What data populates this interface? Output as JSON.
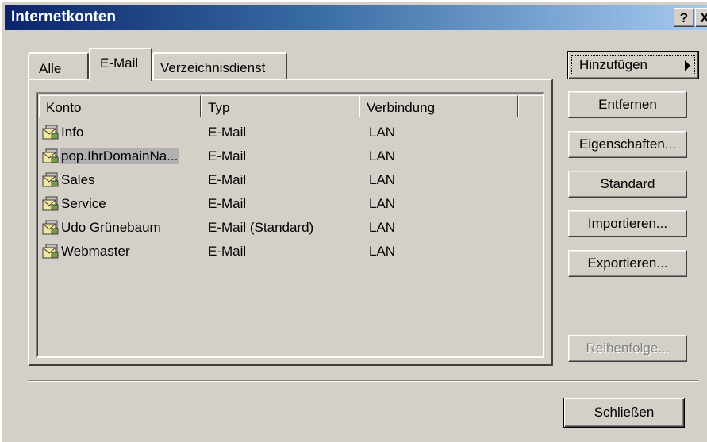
{
  "window": {
    "title": "Internetkonten"
  },
  "titlebar": {
    "help_label": "?",
    "close_label": "X"
  },
  "tabs": [
    {
      "label": "Alle"
    },
    {
      "label": "E-Mail",
      "selected": true
    },
    {
      "label": "Verzeichnisdienst"
    }
  ],
  "list": {
    "columns": [
      "Konto",
      "Typ",
      "Verbindung"
    ],
    "rows": [
      {
        "konto": "Info",
        "typ": "E-Mail",
        "verbindung": "LAN"
      },
      {
        "konto": "pop.IhrDomainNa...",
        "typ": "E-Mail",
        "verbindung": "LAN",
        "selected": true
      },
      {
        "konto": "Sales",
        "typ": "E-Mail",
        "verbindung": "LAN"
      },
      {
        "konto": "Service",
        "typ": "E-Mail",
        "verbindung": "LAN"
      },
      {
        "konto": "Udo Grünebaum",
        "typ": "E-Mail (Standard)",
        "verbindung": "LAN"
      },
      {
        "konto": "Webmaster",
        "typ": "E-Mail",
        "verbindung": "LAN"
      }
    ],
    "row_icon": "mail-account-icon"
  },
  "buttons": {
    "hinzufuegen": "Hinzufügen",
    "entfernen": "Entfernen",
    "eigenschaften": "Eigenschaften...",
    "standard": "Standard",
    "importieren": "Importieren...",
    "exportieren": "Exportieren...",
    "reihenfolge": "Reihenfolge...",
    "schliessen": "Schließen"
  },
  "colors": {
    "titlebar_start": "#0a246a",
    "titlebar_end": "#a6caf0",
    "dialog_face": "#d4d0c8"
  }
}
